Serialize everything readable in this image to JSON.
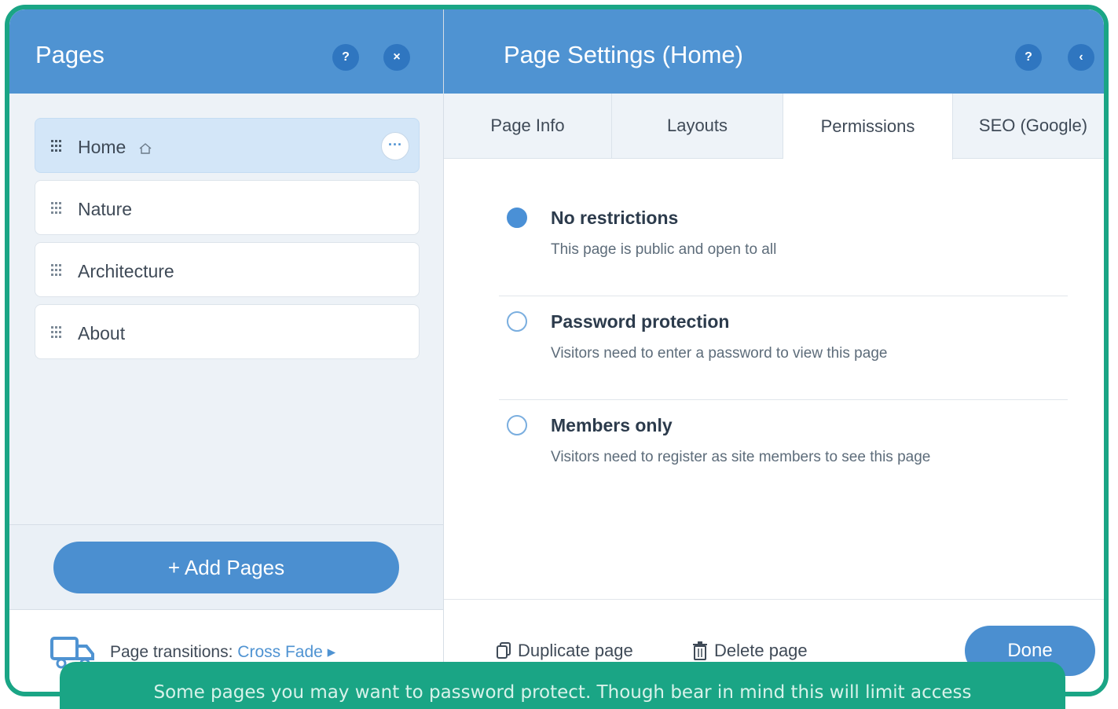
{
  "pages_panel": {
    "title": "Pages",
    "help_label": "?",
    "close_label": "×",
    "pages": [
      {
        "label": "Home",
        "is_home": true,
        "selected": true
      },
      {
        "label": "Nature"
      },
      {
        "label": "Architecture"
      },
      {
        "label": "About"
      }
    ],
    "more_label": "···",
    "add_pages_label": "+ Add Pages",
    "transitions_label": "Page transitions:",
    "transitions_value": "Cross Fade ▸"
  },
  "settings_panel": {
    "title": "Page Settings (Home)",
    "help_label": "?",
    "back_label": "‹",
    "tabs": [
      {
        "label": "Page Info"
      },
      {
        "label": "Layouts"
      },
      {
        "label": "Permissions",
        "active": true
      },
      {
        "label": "SEO (Google)"
      }
    ],
    "options": [
      {
        "title": "No restrictions",
        "desc": "This page is public and open to all",
        "checked": true
      },
      {
        "title": "Password protection",
        "desc": "Visitors need to enter a password to view this page",
        "checked": false
      },
      {
        "title": "Members only",
        "desc": "Visitors need to register as site members to see this page",
        "checked": false
      }
    ],
    "duplicate_label": "Duplicate page",
    "delete_label": "Delete page",
    "done_label": "Done"
  },
  "caption": "Some pages you may want to password protect. Though bear in mind this will limit access",
  "colors": {
    "header_blue": "#4f93d2",
    "accent_green": "#1aa585",
    "button_blue": "#4b8fd0"
  }
}
